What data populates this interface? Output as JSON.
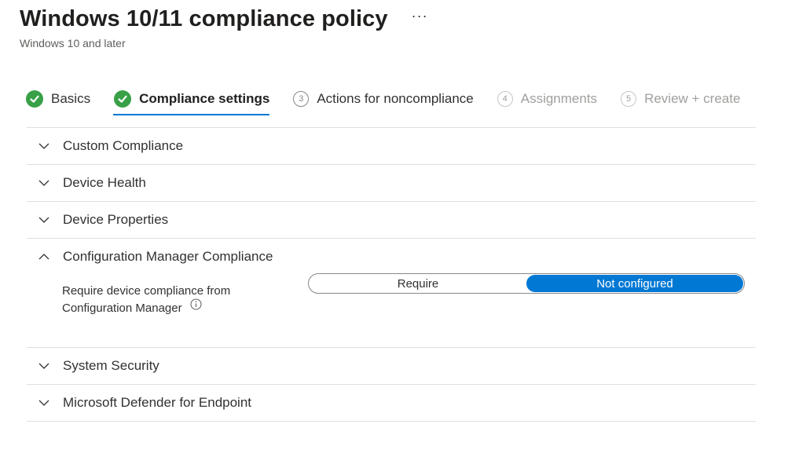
{
  "header": {
    "title": "Windows 10/11 compliance policy",
    "more_label": "···",
    "subtitle": "Windows 10 and later"
  },
  "wizard": {
    "steps": [
      {
        "label": "Basics",
        "state": "completed",
        "number": "1"
      },
      {
        "label": "Compliance settings",
        "state": "current",
        "number": "2"
      },
      {
        "label": "Actions for noncompliance",
        "state": "upcoming",
        "number": "3"
      },
      {
        "label": "Assignments",
        "state": "disabled",
        "number": "4"
      },
      {
        "label": "Review + create",
        "state": "disabled",
        "number": "5"
      }
    ]
  },
  "sections": [
    {
      "title": "Custom Compliance",
      "expanded": false
    },
    {
      "title": "Device Health",
      "expanded": false
    },
    {
      "title": "Device Properties",
      "expanded": false
    },
    {
      "title": "Configuration Manager Compliance",
      "expanded": true,
      "setting": {
        "label_line1": "Require device compliance from",
        "label_line2": "Configuration Manager",
        "options": [
          "Require",
          "Not configured"
        ],
        "selected": "Not configured"
      }
    },
    {
      "title": "System Security",
      "expanded": false
    },
    {
      "title": "Microsoft Defender for Endpoint",
      "expanded": false
    }
  ],
  "colors": {
    "accent": "#0078d4",
    "success": "#38a047",
    "divider": "#e1dfdd"
  },
  "icons": {
    "completed_step": "checkmark-circle-icon",
    "collapsed": "chevron-down-icon",
    "expanded": "chevron-up-icon",
    "info": "info-icon"
  }
}
